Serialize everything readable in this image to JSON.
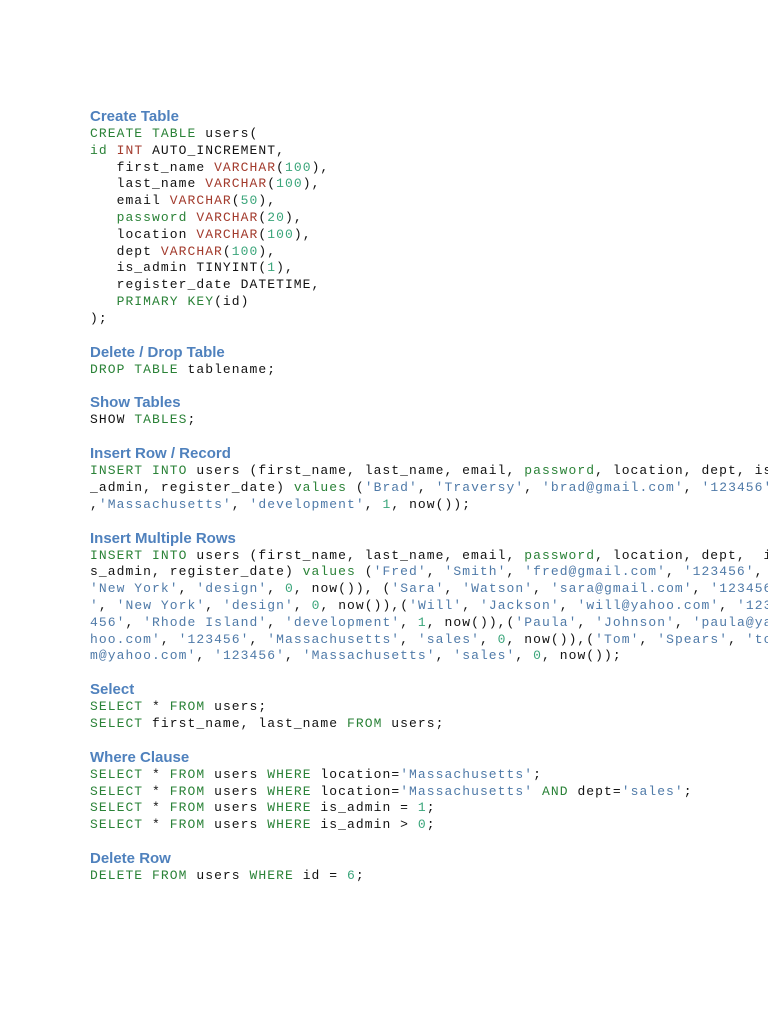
{
  "sections": [
    {
      "title": "Create Table",
      "lines": [
        [
          [
            "k",
            "CREATE TABLE"
          ],
          [
            "p",
            " users("
          ]
        ],
        [
          [
            "k",
            "id"
          ],
          [
            "p",
            " "
          ],
          [
            "t",
            "INT"
          ],
          [
            "p",
            " AUTO_INCREMENT,"
          ]
        ],
        [
          [
            "p",
            "   first_name "
          ],
          [
            "t",
            "VARCHAR"
          ],
          [
            "p",
            "("
          ],
          [
            "n",
            "100"
          ],
          [
            "p",
            "),"
          ]
        ],
        [
          [
            "p",
            "   last_name "
          ],
          [
            "t",
            "VARCHAR"
          ],
          [
            "p",
            "("
          ],
          [
            "n",
            "100"
          ],
          [
            "p",
            "),"
          ]
        ],
        [
          [
            "p",
            "   email "
          ],
          [
            "t",
            "VARCHAR"
          ],
          [
            "p",
            "("
          ],
          [
            "n",
            "50"
          ],
          [
            "p",
            "),"
          ]
        ],
        [
          [
            "k",
            "   password"
          ],
          [
            "p",
            " "
          ],
          [
            "t",
            "VARCHAR"
          ],
          [
            "p",
            "("
          ],
          [
            "n",
            "20"
          ],
          [
            "p",
            "),"
          ]
        ],
        [
          [
            "p",
            "   location "
          ],
          [
            "t",
            "VARCHAR"
          ],
          [
            "p",
            "("
          ],
          [
            "n",
            "100"
          ],
          [
            "p",
            "),"
          ]
        ],
        [
          [
            "p",
            "   dept "
          ],
          [
            "t",
            "VARCHAR"
          ],
          [
            "p",
            "("
          ],
          [
            "n",
            "100"
          ],
          [
            "p",
            "),"
          ]
        ],
        [
          [
            "p",
            "   is_admin TINYINT("
          ],
          [
            "n",
            "1"
          ],
          [
            "p",
            "),"
          ]
        ],
        [
          [
            "p",
            "   register_date DATETIME,"
          ]
        ],
        [
          [
            "k",
            "   PRIMARY KEY"
          ],
          [
            "p",
            "(id)"
          ]
        ],
        [
          [
            "p",
            ");"
          ]
        ]
      ]
    },
    {
      "title": "Delete / Drop Table",
      "lines": [
        [
          [
            "k",
            "DROP TABLE"
          ],
          [
            "p",
            " tablename;"
          ]
        ]
      ]
    },
    {
      "title": "Show Tables",
      "lines": [
        [
          [
            "p",
            "SHOW "
          ],
          [
            "k",
            "TABLES"
          ],
          [
            "p",
            ";"
          ]
        ]
      ]
    },
    {
      "title": "Insert Row / Record",
      "lines": [
        [
          [
            "k",
            "INSERT INTO"
          ],
          [
            "p",
            " users (first_name, last_name, email, "
          ],
          [
            "k",
            "password"
          ],
          [
            "p",
            ", location, dept, is"
          ]
        ],
        [
          [
            "p",
            "_admin, register_date) "
          ],
          [
            "k",
            "values"
          ],
          [
            "p",
            " ("
          ],
          [
            "s",
            "'Brad'"
          ],
          [
            "p",
            ", "
          ],
          [
            "s",
            "'Traversy'"
          ],
          [
            "p",
            ", "
          ],
          [
            "s",
            "'brad@gmail.com'"
          ],
          [
            "p",
            ", "
          ],
          [
            "s",
            "'123456'"
          ]
        ],
        [
          [
            "p",
            ","
          ],
          [
            "s",
            "'Massachusetts'"
          ],
          [
            "p",
            ", "
          ],
          [
            "s",
            "'development'"
          ],
          [
            "p",
            ", "
          ],
          [
            "n",
            "1"
          ],
          [
            "p",
            ", now());"
          ]
        ]
      ]
    },
    {
      "title": "Insert Multiple Rows",
      "lines": [
        [
          [
            "k",
            "INSERT INTO"
          ],
          [
            "p",
            " users (first_name, last_name, email, "
          ],
          [
            "k",
            "password"
          ],
          [
            "p",
            ", location, dept,  i"
          ]
        ],
        [
          [
            "p",
            "s_admin, register_date) "
          ],
          [
            "k",
            "values"
          ],
          [
            "p",
            " ("
          ],
          [
            "s",
            "'Fred'"
          ],
          [
            "p",
            ", "
          ],
          [
            "s",
            "'Smith'"
          ],
          [
            "p",
            ", "
          ],
          [
            "s",
            "'fred@gmail.com'"
          ],
          [
            "p",
            ", "
          ],
          [
            "s",
            "'123456'"
          ],
          [
            "p",
            ","
          ]
        ],
        [
          [
            "s",
            "'New York'"
          ],
          [
            "p",
            ", "
          ],
          [
            "s",
            "'design'"
          ],
          [
            "p",
            ", "
          ],
          [
            "n",
            "0"
          ],
          [
            "p",
            ", now()), ("
          ],
          [
            "s",
            "'Sara'"
          ],
          [
            "p",
            ", "
          ],
          [
            "s",
            "'Watson'"
          ],
          [
            "p",
            ", "
          ],
          [
            "s",
            "'sara@gmail.com'"
          ],
          [
            "p",
            ", "
          ],
          [
            "s",
            "'123456"
          ]
        ],
        [
          [
            "s",
            "'"
          ],
          [
            "p",
            ", "
          ],
          [
            "s",
            "'New York'"
          ],
          [
            "p",
            ", "
          ],
          [
            "s",
            "'design'"
          ],
          [
            "p",
            ", "
          ],
          [
            "n",
            "0"
          ],
          [
            "p",
            ", now()),("
          ],
          [
            "s",
            "'Will'"
          ],
          [
            "p",
            ", "
          ],
          [
            "s",
            "'Jackson'"
          ],
          [
            "p",
            ", "
          ],
          [
            "s",
            "'will@yahoo.com'"
          ],
          [
            "p",
            ", "
          ],
          [
            "s",
            "'123"
          ]
        ],
        [
          [
            "s",
            "456'"
          ],
          [
            "p",
            ", "
          ],
          [
            "s",
            "'Rhode Island'"
          ],
          [
            "p",
            ", "
          ],
          [
            "s",
            "'development'"
          ],
          [
            "p",
            ", "
          ],
          [
            "n",
            "1"
          ],
          [
            "p",
            ", now()),("
          ],
          [
            "s",
            "'Paula'"
          ],
          [
            "p",
            ", "
          ],
          [
            "s",
            "'Johnson'"
          ],
          [
            "p",
            ", "
          ],
          [
            "s",
            "'paula@ya"
          ]
        ],
        [
          [
            "s",
            "hoo.com'"
          ],
          [
            "p",
            ", "
          ],
          [
            "s",
            "'123456'"
          ],
          [
            "p",
            ", "
          ],
          [
            "s",
            "'Massachusetts'"
          ],
          [
            "p",
            ", "
          ],
          [
            "s",
            "'sales'"
          ],
          [
            "p",
            ", "
          ],
          [
            "n",
            "0"
          ],
          [
            "p",
            ", now()),("
          ],
          [
            "s",
            "'Tom'"
          ],
          [
            "p",
            ", "
          ],
          [
            "s",
            "'Spears'"
          ],
          [
            "p",
            ", "
          ],
          [
            "s",
            "'to"
          ]
        ],
        [
          [
            "s",
            "m@yahoo.com'"
          ],
          [
            "p",
            ", "
          ],
          [
            "s",
            "'123456'"
          ],
          [
            "p",
            ", "
          ],
          [
            "s",
            "'Massachusetts'"
          ],
          [
            "p",
            ", "
          ],
          [
            "s",
            "'sales'"
          ],
          [
            "p",
            ", "
          ],
          [
            "n",
            "0"
          ],
          [
            "p",
            ", now());"
          ]
        ]
      ]
    },
    {
      "title": "Select",
      "lines": [
        [
          [
            "k",
            "SELECT"
          ],
          [
            "p",
            " * "
          ],
          [
            "k",
            "FROM"
          ],
          [
            "p",
            " users;"
          ]
        ],
        [
          [
            "k",
            "SELECT"
          ],
          [
            "p",
            " first_name, last_name "
          ],
          [
            "k",
            "FROM"
          ],
          [
            "p",
            " users;"
          ]
        ]
      ]
    },
    {
      "title": "Where Clause",
      "lines": [
        [
          [
            "k",
            "SELECT"
          ],
          [
            "p",
            " * "
          ],
          [
            "k",
            "FROM"
          ],
          [
            "p",
            " users "
          ],
          [
            "k",
            "WHERE"
          ],
          [
            "p",
            " location="
          ],
          [
            "s",
            "'Massachusetts'"
          ],
          [
            "p",
            ";"
          ]
        ],
        [
          [
            "k",
            "SELECT"
          ],
          [
            "p",
            " * "
          ],
          [
            "k",
            "FROM"
          ],
          [
            "p",
            " users "
          ],
          [
            "k",
            "WHERE"
          ],
          [
            "p",
            " location="
          ],
          [
            "s",
            "'Massachusetts'"
          ],
          [
            "p",
            " "
          ],
          [
            "k",
            "AND"
          ],
          [
            "p",
            " dept="
          ],
          [
            "s",
            "'sales'"
          ],
          [
            "p",
            ";"
          ]
        ],
        [
          [
            "k",
            "SELECT"
          ],
          [
            "p",
            " * "
          ],
          [
            "k",
            "FROM"
          ],
          [
            "p",
            " users "
          ],
          [
            "k",
            "WHERE"
          ],
          [
            "p",
            " is_admin = "
          ],
          [
            "n",
            "1"
          ],
          [
            "p",
            ";"
          ]
        ],
        [
          [
            "k",
            "SELECT"
          ],
          [
            "p",
            " * "
          ],
          [
            "k",
            "FROM"
          ],
          [
            "p",
            " users "
          ],
          [
            "k",
            "WHERE"
          ],
          [
            "p",
            " is_admin > "
          ],
          [
            "n",
            "0"
          ],
          [
            "p",
            ";"
          ]
        ]
      ]
    },
    {
      "title": "Delete Row",
      "lines": [
        [
          [
            "k",
            "DELETE FROM"
          ],
          [
            "p",
            " users "
          ],
          [
            "k",
            "WHERE"
          ],
          [
            "p",
            " id = "
          ],
          [
            "n",
            "6"
          ],
          [
            "p",
            ";"
          ]
        ]
      ]
    }
  ]
}
